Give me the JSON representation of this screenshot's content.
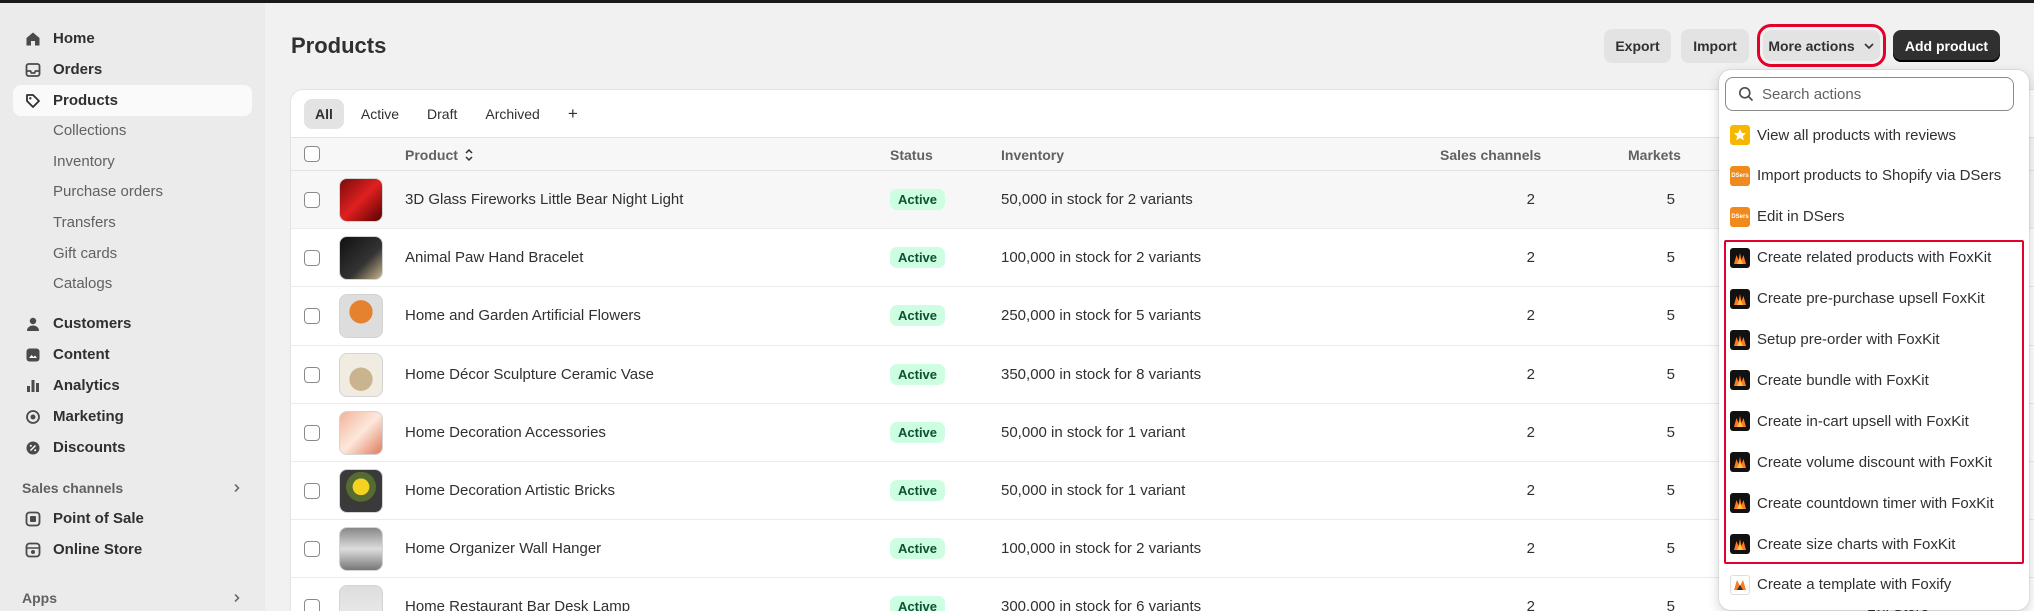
{
  "sidebar": {
    "items": [
      {
        "label": "Home",
        "icon": "home-icon"
      },
      {
        "label": "Orders",
        "icon": "inbox-icon"
      },
      {
        "label": "Products",
        "icon": "tag-icon",
        "active": true
      }
    ],
    "product_subitems": [
      "Collections",
      "Inventory",
      "Purchase orders",
      "Transfers",
      "Gift cards",
      "Catalogs"
    ],
    "items2": [
      {
        "label": "Customers",
        "icon": "person-icon"
      },
      {
        "label": "Content",
        "icon": "content-icon"
      },
      {
        "label": "Analytics",
        "icon": "bar-chart-icon"
      },
      {
        "label": "Marketing",
        "icon": "target-icon"
      },
      {
        "label": "Discounts",
        "icon": "discount-icon"
      }
    ],
    "sales_channels_label": "Sales channels",
    "channels": [
      {
        "label": "Point of Sale",
        "icon": "pos-icon"
      },
      {
        "label": "Online Store",
        "icon": "store-icon"
      }
    ],
    "apps_label": "Apps"
  },
  "header": {
    "title": "Products",
    "export_label": "Export",
    "import_label": "Import",
    "more_actions_label": "More actions",
    "add_product_label": "Add product"
  },
  "tabs": [
    "All",
    "Active",
    "Draft",
    "Archived",
    "+"
  ],
  "table": {
    "columns": [
      "Product",
      "Status",
      "Inventory",
      "Sales channels",
      "Markets"
    ],
    "rows": [
      {
        "name": "3D Glass Fireworks Little Bear Night Light",
        "status": "Active",
        "inventory": "50,000 in stock for 2 variants",
        "channels": "2",
        "markets": "5"
      },
      {
        "name": "Animal Paw Hand Bracelet",
        "status": "Active",
        "inventory": "100,000 in stock for 2 variants",
        "channels": "2",
        "markets": "5"
      },
      {
        "name": "Home and Garden Artificial Flowers",
        "status": "Active",
        "inventory": "250,000 in stock for 5 variants",
        "channels": "2",
        "markets": "5"
      },
      {
        "name": "Home Décor Sculpture Ceramic Vase",
        "status": "Active",
        "inventory": "350,000 in stock for 8 variants",
        "channels": "2",
        "markets": "5"
      },
      {
        "name": "Home Decoration Accessories",
        "status": "Active",
        "inventory": "50,000 in stock for 1 variant",
        "channels": "2",
        "markets": "5"
      },
      {
        "name": "Home Decoration Artistic Bricks",
        "status": "Active",
        "inventory": "50,000 in stock for 1 variant",
        "channels": "2",
        "markets": "5"
      },
      {
        "name": "Home Organizer Wall Hanger",
        "status": "Active",
        "inventory": "100,000 in stock for 2 variants",
        "channels": "2",
        "markets": "5"
      },
      {
        "name": "Home Restaurant Bar Desk Lamp",
        "status": "Active",
        "inventory": "300,000 in stock for 6 variants",
        "channels": "2",
        "markets": "5",
        "extra": "Lyli Store"
      }
    ]
  },
  "dropdown": {
    "search_placeholder": "Search actions",
    "items": [
      {
        "label": "View all products with reviews",
        "icon": "star-icon"
      },
      {
        "label": "Import products to Shopify via DSers",
        "icon": "dsers-icon"
      },
      {
        "label": "Edit in DSers",
        "icon": "dsers-icon"
      },
      {
        "label": "Create related products with FoxKit",
        "icon": "foxkit-icon"
      },
      {
        "label": "Create pre-purchase upsell FoxKit",
        "icon": "foxkit-icon"
      },
      {
        "label": "Setup pre-order with FoxKit",
        "icon": "foxkit-icon"
      },
      {
        "label": "Create bundle with FoxKit",
        "icon": "foxkit-icon"
      },
      {
        "label": "Create in-cart upsell with FoxKit",
        "icon": "foxkit-icon"
      },
      {
        "label": "Create volume discount with FoxKit",
        "icon": "foxkit-icon"
      },
      {
        "label": "Create countdown timer with FoxKit",
        "icon": "foxkit-icon"
      },
      {
        "label": "Create size charts with FoxKit",
        "icon": "foxkit-icon"
      },
      {
        "label": "Create a template with Foxify",
        "icon": "foxify-icon"
      }
    ],
    "dsers_icon_text": "DSers"
  },
  "colors": {
    "highlight": "#e3002b",
    "badge_bg": "#cdfee1",
    "badge_text": "#0c5132",
    "primary_button": "#303030",
    "star_icon": "#f5b700",
    "dsers_icon": "#f08a1c",
    "foxkit_icon": "#111111"
  }
}
